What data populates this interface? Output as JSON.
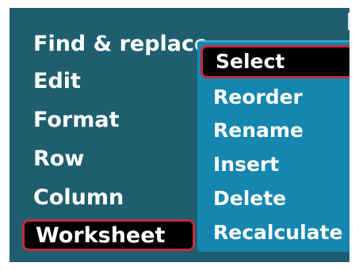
{
  "main_menu": {
    "items": [
      {
        "label": "Find & replace"
      },
      {
        "label": "Edit"
      },
      {
        "label": "Format"
      },
      {
        "label": "Row"
      },
      {
        "label": "Column"
      },
      {
        "label": "Worksheet"
      }
    ],
    "selected_index": 5
  },
  "submenu": {
    "items": [
      {
        "label": "Select"
      },
      {
        "label": "Reorder"
      },
      {
        "label": "Rename"
      },
      {
        "label": "Insert"
      },
      {
        "label": "Delete"
      },
      {
        "label": "Recalculate"
      }
    ],
    "selected_index": 0
  },
  "colors": {
    "background": "#1f5e6f",
    "submenu_background": "#1586b0",
    "highlight_fill": "#000000",
    "highlight_border": "#c8283c",
    "text": "#ffffff"
  }
}
